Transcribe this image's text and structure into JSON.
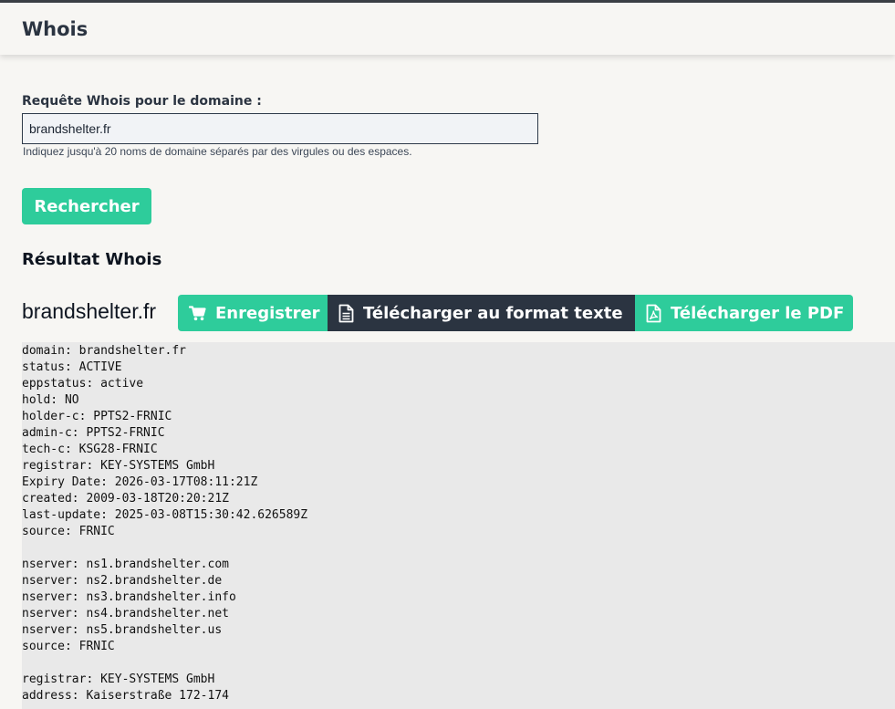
{
  "header": {
    "title": "Whois"
  },
  "form": {
    "label": "Requête Whois pour le domaine :",
    "value": "brandshelter.fr",
    "hint": "Indiquez jusqu'à 20 noms de domaine séparés par des virgules ou des espaces.",
    "submit_label": "Rechercher"
  },
  "result": {
    "heading": "Résultat Whois",
    "domain": "brandshelter.fr",
    "actions": {
      "register_label": "Enregistrer",
      "download_text_label": "Télécharger au format texte",
      "download_pdf_label": "Télécharger le PDF"
    },
    "lines": [
      "domain: brandshelter.fr",
      "status: ACTIVE",
      "eppstatus: active",
      "hold: NO",
      "holder-c: PPTS2-FRNIC",
      "admin-c: PPTS2-FRNIC",
      "tech-c: KSG28-FRNIC",
      "registrar: KEY-SYSTEMS GmbH",
      "Expiry Date: 2026-03-17T08:11:21Z",
      "created: 2009-03-18T20:20:21Z",
      "last-update: 2025-03-08T15:30:42.626589Z",
      "source: FRNIC",
      "",
      "nserver: ns1.brandshelter.com",
      "nserver: ns2.brandshelter.de",
      "nserver: ns3.brandshelter.info",
      "nserver: ns4.brandshelter.net",
      "nserver: ns5.brandshelter.us",
      "source: FRNIC",
      "",
      "registrar: KEY-SYSTEMS GmbH",
      "address: Kaiserstraße 172-174"
    ]
  },
  "colors": {
    "accent": "#2ecc9b",
    "dark": "#2b3441",
    "background": "#f7f6f3",
    "output_bg": "#e9e9e9"
  },
  "icons": {
    "register": "shopping-cart-icon",
    "download_text": "text-file-icon",
    "download_pdf": "pdf-file-icon"
  }
}
